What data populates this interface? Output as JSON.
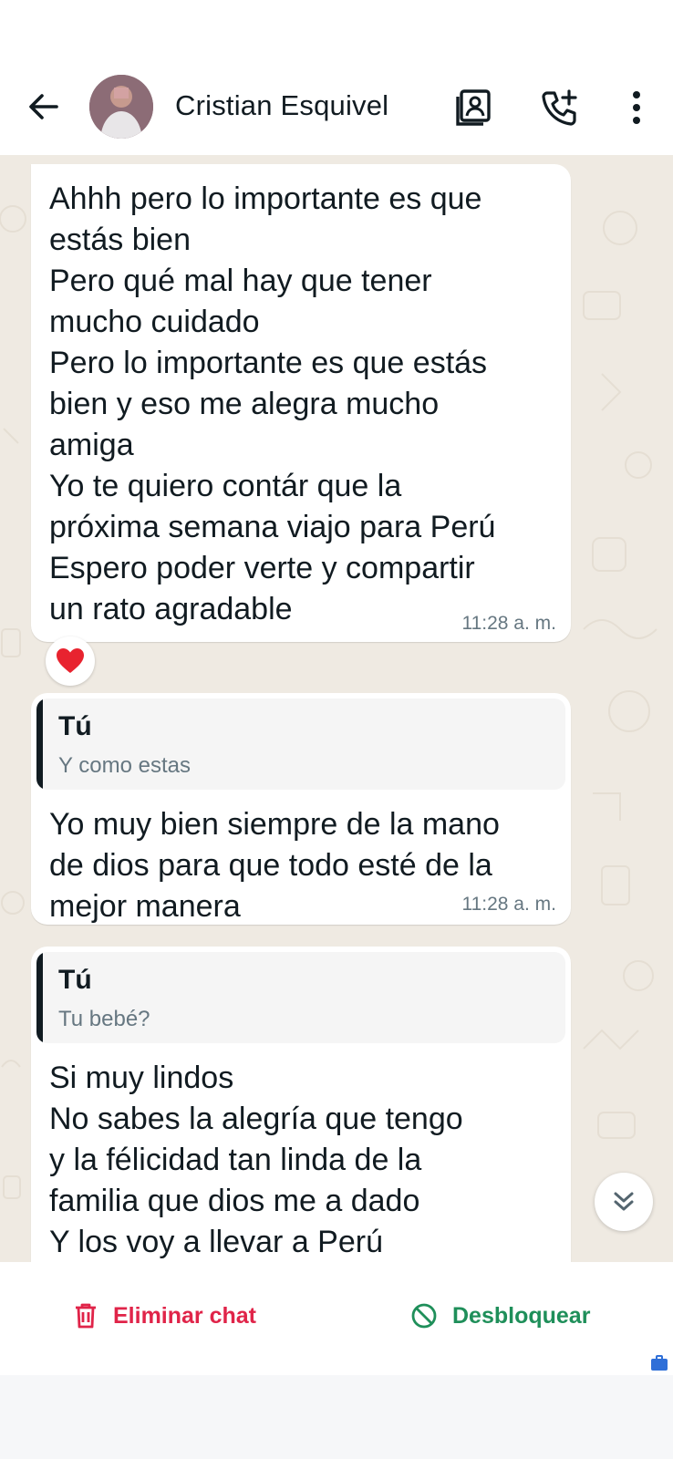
{
  "header": {
    "contact_name": "Cristian Esquivel",
    "icons": [
      "back-arrow-icon",
      "contact-card-icon",
      "add-call-icon",
      "more-vert-icon"
    ]
  },
  "messages": [
    {
      "text": "Ahhh pero lo importante es que\nestás bien\nPero qué mal hay que tener\nmucho cuidado\nPero lo importante es que estás\nbien y eso me alegra mucho\namiga\nYo te quiero contár que la\npróxima semana viajo para Perú\nEspero poder verte y compartir\nun rato agradable",
      "time": "11:28 a. m.",
      "reaction": "❤"
    },
    {
      "quote_author": "Tú",
      "quote_text": "Y como estas",
      "text": "Yo muy bien siempre de la mano\nde dios para que todo esté de la\nmejor manera",
      "time": "11:28 a. m."
    },
    {
      "quote_author": "Tú",
      "quote_text": "Tu bebé?",
      "text": "Si muy lindos\nNo sabes la alegría que tengo\ny la félicidad tan linda de la\nfamilia que dios me a dado\nY los voy a llevar a Perú\nPara que los conozcan"
    }
  ],
  "actions": {
    "delete_label": "Eliminar chat",
    "unblock_label": "Desbloquear"
  },
  "colors": {
    "delete": "#e02449",
    "unblock": "#1f8f5a",
    "chat_background": "#efeae2"
  }
}
